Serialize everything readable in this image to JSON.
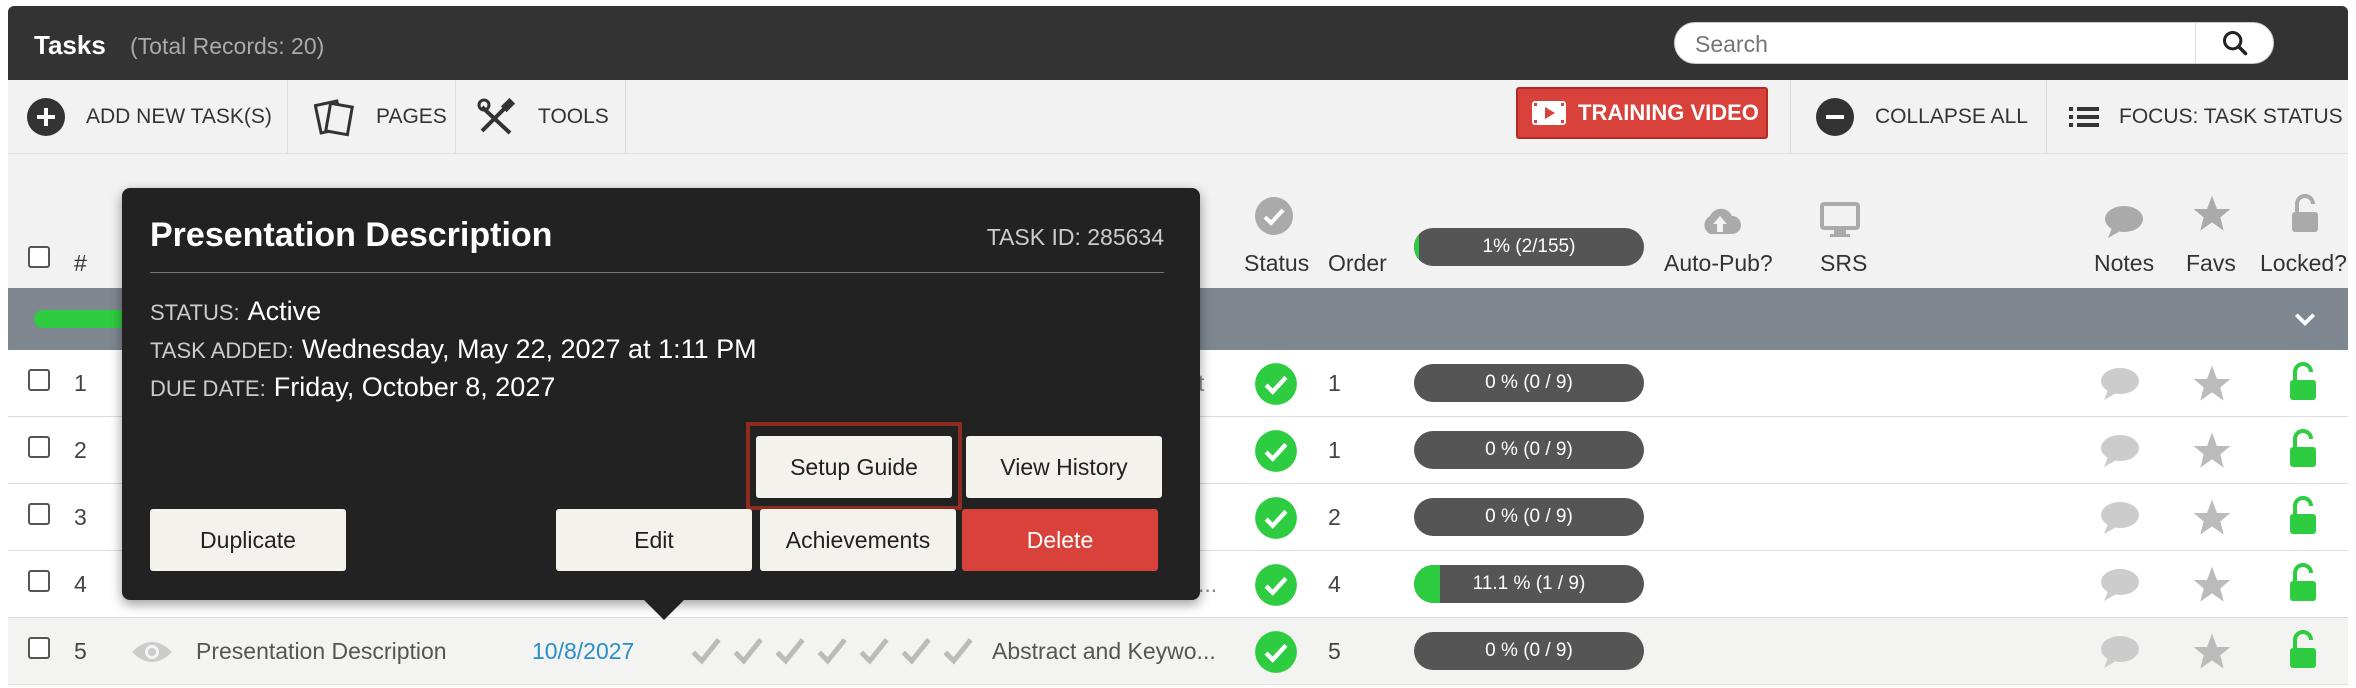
{
  "header": {
    "title": "Tasks",
    "total_records": "(Total Records: 20)",
    "search_placeholder": "Search"
  },
  "toolbar": {
    "add_new": "ADD NEW TASK(S)",
    "pages": "PAGES",
    "tools": "TOOLS",
    "training_video": "TRAINING VIDEO",
    "collapse_all": "COLLAPSE ALL",
    "focus": "FOCUS: TASK STATUS"
  },
  "columns": {
    "num": "#",
    "status": "Status",
    "order": "Order",
    "progress": "1% (2/155)",
    "progress_fraction": 0.01,
    "auto_pub": "Auto-Pub?",
    "srs": "SRS",
    "notes": "Notes",
    "favs": "Favs",
    "locked": "Locked?"
  },
  "rows": [
    {
      "num": "1",
      "order": "1",
      "progress": "0 % (0 / 9)",
      "fraction": 0.0,
      "trunc": "t"
    },
    {
      "num": "2",
      "order": "1",
      "progress": "0 % (0 / 9)",
      "fraction": 0.0,
      "trunc": ""
    },
    {
      "num": "3",
      "order": "2",
      "progress": "0 % (0 / 9)",
      "fraction": 0.0,
      "trunc": ""
    },
    {
      "num": "4",
      "order": "4",
      "progress": "11.1 % (1 / 9)",
      "fraction": 0.111,
      "trunc": "..."
    },
    {
      "num": "5",
      "order": "5",
      "progress": "0 % (0 / 9)",
      "fraction": 0.0,
      "title": "Presentation Description",
      "date": "10/8/2027",
      "abstract": "Abstract and Keywo..."
    }
  ],
  "popover": {
    "title": "Presentation Description",
    "task_id": "TASK ID: 285634",
    "status_label": "STATUS:",
    "status_value": "Active",
    "added_label": "TASK ADDED:",
    "added_value": "Wednesday, May 22, 2027 at 1:11 PM",
    "due_label": "DUE DATE:",
    "due_value": "Friday, October 8, 2027",
    "setup_guide": "Setup Guide",
    "view_history": "View History",
    "duplicate": "Duplicate",
    "edit": "Edit",
    "achievements": "Achievements",
    "delete": "Delete"
  },
  "colors": {
    "header_bg": "#333333",
    "accent_red": "#d9413b",
    "success_green": "#2ecc40",
    "popover_bg": "#222222",
    "link_blue": "#2a8fc9"
  }
}
